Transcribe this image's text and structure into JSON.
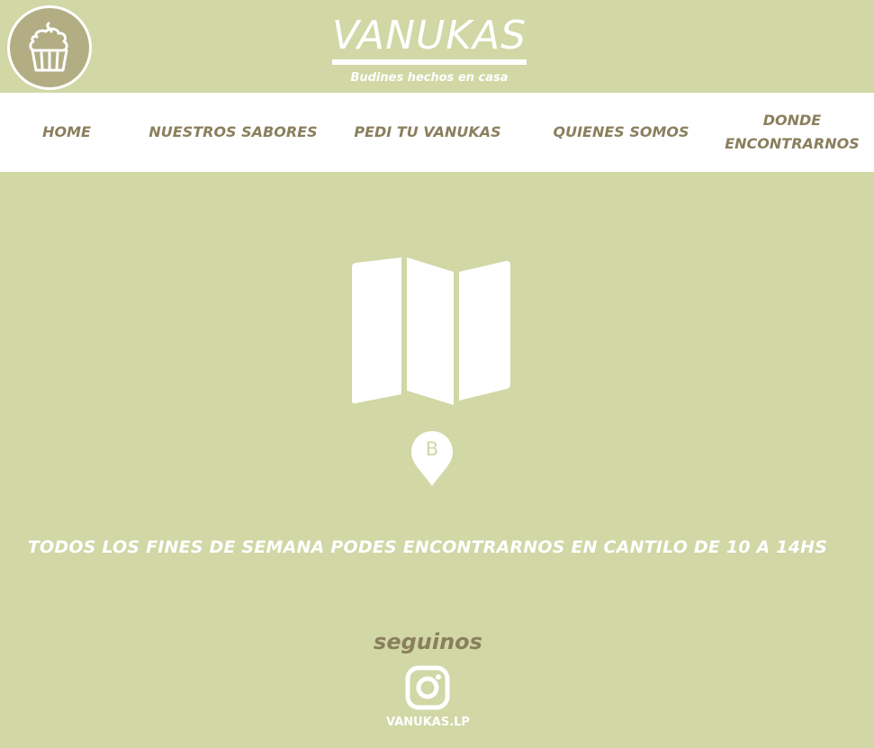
{
  "brand": {
    "title": "VANUKAS",
    "tagline": "Budines hechos en casa",
    "logo_icon": "cupcake-icon"
  },
  "nav": {
    "items": [
      {
        "label": "HOME"
      },
      {
        "label": "NUESTROS SABORES"
      },
      {
        "label": "PEDI TU VANUKAS"
      },
      {
        "label": "QUIENES SOMOS"
      },
      {
        "label": "DONDE\nENCONTRARNOS"
      }
    ]
  },
  "main": {
    "map_icon": "map-icon",
    "pin_icon": "map-pin-icon",
    "pin_letter": "B",
    "schedule_text": "TODOS LOS FINES DE SEMANA PODES ENCONTRARNOS EN CANTILO DE 10 A 14HS"
  },
  "footer": {
    "follow_label": "seguinos",
    "social_icon": "instagram-icon",
    "handle": "VANUKAS.LP"
  },
  "colors": {
    "background": "#d1d7a5",
    "nav_background": "#ffffff",
    "accent_text": "#8a7f5d",
    "logo_badge": "#b3ad84",
    "white": "#ffffff"
  }
}
